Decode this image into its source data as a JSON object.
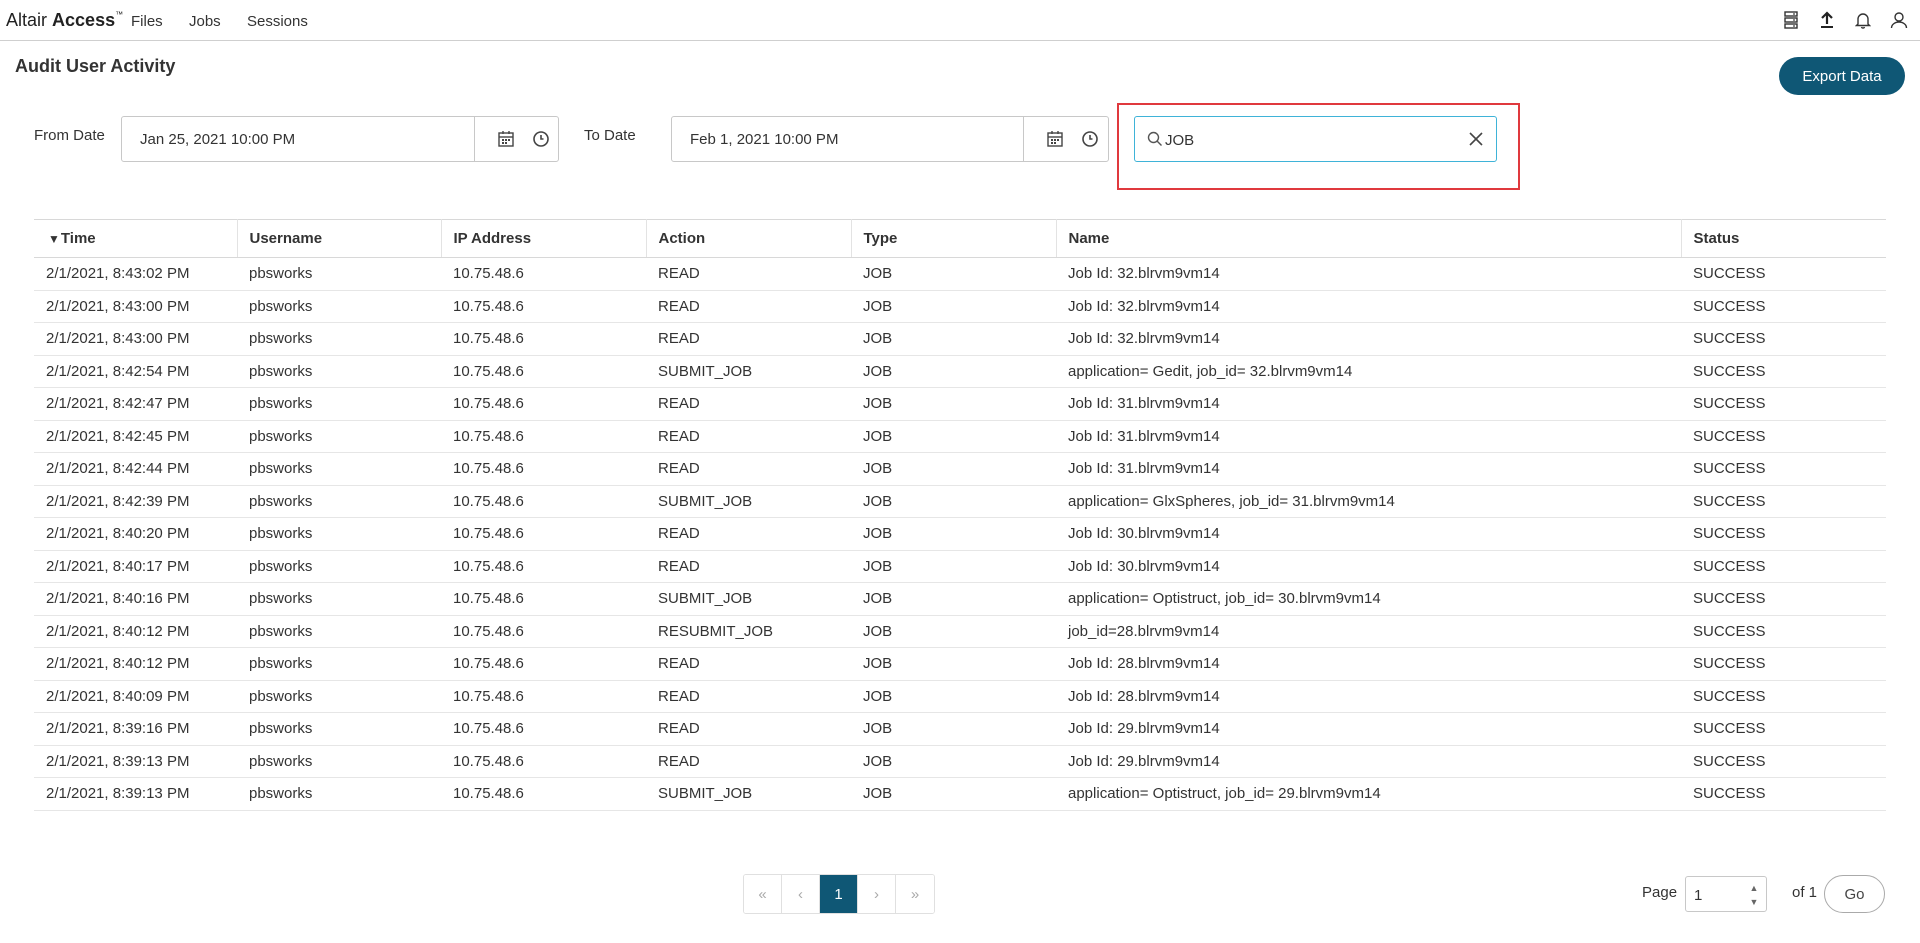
{
  "app": {
    "brand_part1": "Altair",
    "brand_part2": "Access",
    "brand_tm": "™",
    "nav": [
      "Files",
      "Jobs",
      "Sessions"
    ]
  },
  "header": {
    "title": "Audit User Activity",
    "export_label": "Export Data"
  },
  "filters": {
    "from_label": "From Date",
    "from_value": "Jan 25, 2021 10:00 PM",
    "to_label": "To Date",
    "to_value": "Feb 1, 2021 10:00 PM",
    "search_value": "JOB"
  },
  "table": {
    "sort_indicator": "▼",
    "columns": [
      "Time",
      "Username",
      "IP Address",
      "Action",
      "Type",
      "Name",
      "Status"
    ],
    "rows": [
      [
        "2/1/2021, 8:43:02 PM",
        "pbsworks",
        "10.75.48.6",
        "READ",
        "JOB",
        "Job Id: 32.blrvm9vm14",
        "SUCCESS"
      ],
      [
        "2/1/2021, 8:43:00 PM",
        "pbsworks",
        "10.75.48.6",
        "READ",
        "JOB",
        "Job Id: 32.blrvm9vm14",
        "SUCCESS"
      ],
      [
        "2/1/2021, 8:43:00 PM",
        "pbsworks",
        "10.75.48.6",
        "READ",
        "JOB",
        "Job Id: 32.blrvm9vm14",
        "SUCCESS"
      ],
      [
        "2/1/2021, 8:42:54 PM",
        "pbsworks",
        "10.75.48.6",
        "SUBMIT_JOB",
        "JOB",
        "application= Gedit, job_id= 32.blrvm9vm14",
        "SUCCESS"
      ],
      [
        "2/1/2021, 8:42:47 PM",
        "pbsworks",
        "10.75.48.6",
        "READ",
        "JOB",
        "Job Id: 31.blrvm9vm14",
        "SUCCESS"
      ],
      [
        "2/1/2021, 8:42:45 PM",
        "pbsworks",
        "10.75.48.6",
        "READ",
        "JOB",
        "Job Id: 31.blrvm9vm14",
        "SUCCESS"
      ],
      [
        "2/1/2021, 8:42:44 PM",
        "pbsworks",
        "10.75.48.6",
        "READ",
        "JOB",
        "Job Id: 31.blrvm9vm14",
        "SUCCESS"
      ],
      [
        "2/1/2021, 8:42:39 PM",
        "pbsworks",
        "10.75.48.6",
        "SUBMIT_JOB",
        "JOB",
        "application= GlxSpheres, job_id= 31.blrvm9vm14",
        "SUCCESS"
      ],
      [
        "2/1/2021, 8:40:20 PM",
        "pbsworks",
        "10.75.48.6",
        "READ",
        "JOB",
        "Job Id: 30.blrvm9vm14",
        "SUCCESS"
      ],
      [
        "2/1/2021, 8:40:17 PM",
        "pbsworks",
        "10.75.48.6",
        "READ",
        "JOB",
        "Job Id: 30.blrvm9vm14",
        "SUCCESS"
      ],
      [
        "2/1/2021, 8:40:16 PM",
        "pbsworks",
        "10.75.48.6",
        "SUBMIT_JOB",
        "JOB",
        "application= Optistruct, job_id= 30.blrvm9vm14",
        "SUCCESS"
      ],
      [
        "2/1/2021, 8:40:12 PM",
        "pbsworks",
        "10.75.48.6",
        "RESUBMIT_JOB",
        "JOB",
        "job_id=28.blrvm9vm14",
        "SUCCESS"
      ],
      [
        "2/1/2021, 8:40:12 PM",
        "pbsworks",
        "10.75.48.6",
        "READ",
        "JOB",
        "Job Id: 28.blrvm9vm14",
        "SUCCESS"
      ],
      [
        "2/1/2021, 8:40:09 PM",
        "pbsworks",
        "10.75.48.6",
        "READ",
        "JOB",
        "Job Id: 28.blrvm9vm14",
        "SUCCESS"
      ],
      [
        "2/1/2021, 8:39:16 PM",
        "pbsworks",
        "10.75.48.6",
        "READ",
        "JOB",
        "Job Id: 29.blrvm9vm14",
        "SUCCESS"
      ],
      [
        "2/1/2021, 8:39:13 PM",
        "pbsworks",
        "10.75.48.6",
        "READ",
        "JOB",
        "Job Id: 29.blrvm9vm14",
        "SUCCESS"
      ],
      [
        "2/1/2021, 8:39:13 PM",
        "pbsworks",
        "10.75.48.6",
        "SUBMIT_JOB",
        "JOB",
        "application= Optistruct, job_id= 29.blrvm9vm14",
        "SUCCESS"
      ]
    ]
  },
  "pagination": {
    "first": "«",
    "prev": "‹",
    "current": "1",
    "next": "›",
    "last": "»",
    "page_label": "Page",
    "page_value": "1",
    "of_label": "of 1",
    "go_label": "Go"
  },
  "colors": {
    "accent": "#0f5775",
    "search_border": "#3fb3d8",
    "highlight": "#e0393e"
  },
  "icons": {
    "top": [
      "server-icon",
      "upload-icon",
      "bell-icon",
      "user-icon"
    ],
    "date": [
      "calendar-icon",
      "clock-icon"
    ],
    "search": "search-icon",
    "clear": "close-icon"
  }
}
